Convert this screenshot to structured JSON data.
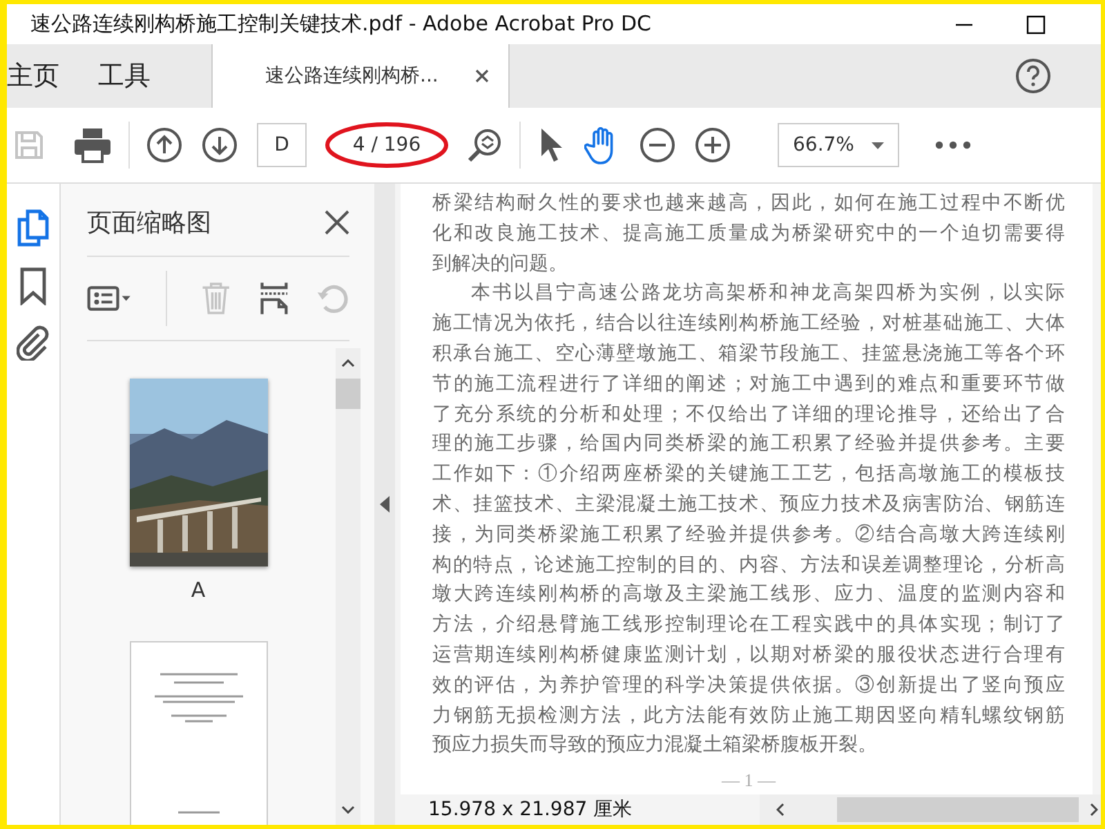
{
  "window": {
    "title": "速公路连续刚构桥施工控制关键技术.pdf - Adobe Acrobat Pro DC"
  },
  "tabs": [
    {
      "label": "主页",
      "kind": "nav",
      "selected": false
    },
    {
      "label": "工具",
      "kind": "nav",
      "selected": false
    },
    {
      "label": "速公路连续刚构桥...",
      "kind": "document",
      "selected": true
    }
  ],
  "toolbar": {
    "groups": [
      [
        {
          "kind": "save",
          "disabled": true
        },
        {
          "kind": "print",
          "disabled": false
        }
      ],
      [
        {
          "kind": "previous_page",
          "disabled": false
        },
        {
          "kind": "next_page",
          "disabled": false
        },
        {
          "kind": "page_field",
          "value": "D"
        },
        {
          "kind": "page_count",
          "text": "4 / 196",
          "circled": true
        },
        {
          "kind": "find",
          "disabled": false
        }
      ],
      [
        {
          "kind": "select",
          "selected": false
        },
        {
          "kind": "hand",
          "selected": true
        },
        {
          "kind": "zoom_out",
          "disabled": false
        },
        {
          "kind": "zoom_in",
          "disabled": false
        },
        {
          "kind": "zoom_select",
          "value": "66.7%"
        },
        {
          "kind": "more",
          "disabled": false
        }
      ]
    ]
  },
  "sidebar": {
    "tabs": [
      {
        "kind": "pages",
        "selected": true
      },
      {
        "kind": "bookmarks",
        "selected": false
      },
      {
        "kind": "attachments",
        "selected": false
      }
    ],
    "title": "页面缩略图",
    "tools": [
      {
        "kind": "options",
        "disabled": false
      },
      {
        "kind": "delete",
        "disabled": true
      },
      {
        "kind": "extract",
        "disabled": false
      },
      {
        "kind": "rotate",
        "disabled": true
      }
    ],
    "thumbnails": [
      {
        "kind": "picture",
        "label": "A"
      },
      {
        "kind": "page"
      }
    ]
  },
  "document": {
    "lines": [
      {
        "kind": "full",
        "text": "桥梁结构耐久性的要求也越来越高，因此，如何在施工过程中不断优"
      },
      {
        "kind": "full",
        "text": "化和改良施工技术、提高施工质量成为桥梁研究中的一个迫切需要得"
      },
      {
        "kind": "end",
        "text": "到解决的问题。"
      },
      {
        "kind": "indent",
        "text": "本书以昌宁高速公路龙坊高架桥和神龙高架四桥为实例，以实际"
      },
      {
        "kind": "full",
        "text": "施工情况为依托，结合以往连续刚构桥施工经验，对桩基础施工、大体"
      },
      {
        "kind": "full",
        "text": "积承台施工、空心薄壁墩施工、箱梁节段施工、挂篮悬浇施工等各个环"
      },
      {
        "kind": "full",
        "text": "节的施工流程进行了详细的阐述；对施工中遇到的难点和重要环节做"
      },
      {
        "kind": "full",
        "text": "了充分系统的分析和处理；不仅给出了详细的理论推导，还给出了合"
      },
      {
        "kind": "full",
        "text": "理的施工步骤，给国内同类桥梁的施工积累了经验并提供参考。主要"
      },
      {
        "kind": "full",
        "text": "工作如下：①介绍两座桥梁的关键施工工艺，包括高墩施工的模板技"
      },
      {
        "kind": "full",
        "text": "术、挂篮技术、主梁混凝土施工技术、预应力技术及病害防治、钢筋连"
      },
      {
        "kind": "full",
        "text": "接，为同类桥梁施工积累了经验并提供参考。②结合高墩大跨连续刚"
      },
      {
        "kind": "full",
        "text": "构的特点，论述施工控制的目的、内容、方法和误差调整理论，分析高"
      },
      {
        "kind": "full",
        "text": "墩大跨连续刚构桥的高墩及主梁施工线形、应力、温度的监测内容和"
      },
      {
        "kind": "full",
        "text": "方法，介绍悬臂施工线形控制理论在工程实践中的具体实现；制订了"
      },
      {
        "kind": "full",
        "text": "运营期连续刚构桥健康监测计划，以期对桥梁的服役状态进行合理有"
      },
      {
        "kind": "full",
        "text": "效的评估，为养护管理的科学决策提供依据。③创新提出了竖向预应"
      },
      {
        "kind": "full",
        "text": "力钢筋无损检测方法，此方法能有效防止施工期因竖向精轧螺纹钢筋"
      },
      {
        "kind": "end",
        "text": "预应力损失而导致的预应力混凝土箱梁桥腹板开裂。"
      }
    ],
    "page_number": "— 1 —"
  },
  "status_bar": {
    "page_size": "15.978 x 21.987 厘米"
  }
}
